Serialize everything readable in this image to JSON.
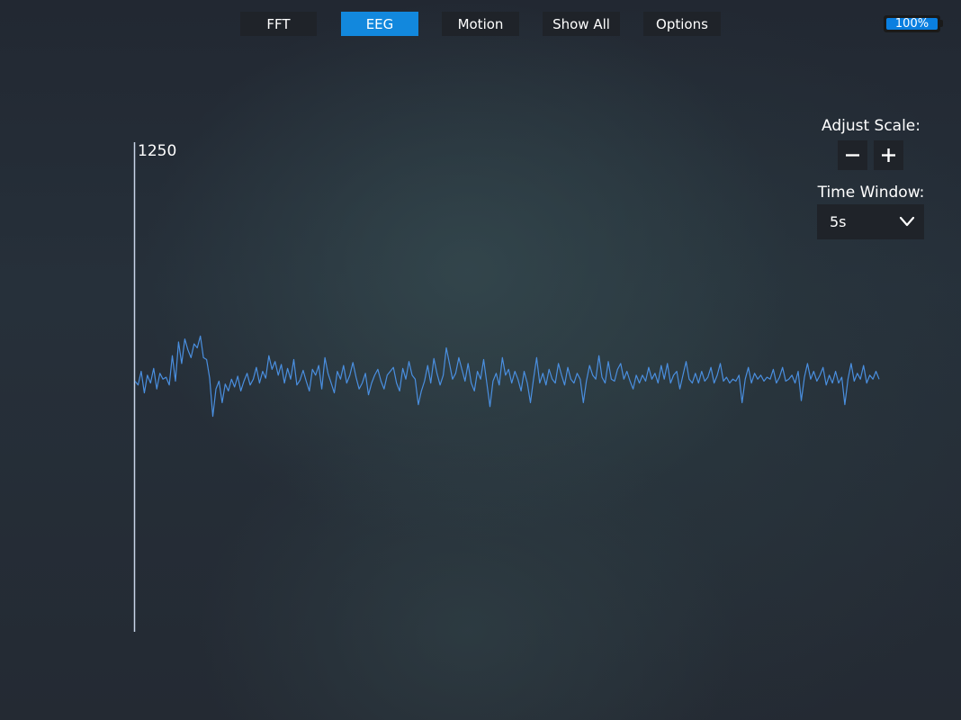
{
  "nav": {
    "tabs": [
      {
        "label": "FFT",
        "active": false
      },
      {
        "label": "EEG",
        "active": true
      },
      {
        "label": "Motion",
        "active": false
      },
      {
        "label": "Show All",
        "active": false
      },
      {
        "label": "Options",
        "active": false
      }
    ]
  },
  "battery": {
    "label": "100%",
    "level": 1.0,
    "color": "#0a7fe0"
  },
  "controls": {
    "adjust_scale_label": "Adjust Scale:",
    "minus_icon": "minus-icon",
    "plus_icon": "plus-icon",
    "time_window_label": "Time Window:",
    "time_window_value": "5s",
    "chevron_icon": "chevron-down-icon"
  },
  "colors": {
    "accent": "#1288dd",
    "signal": "#4a8fe0",
    "axis": "#c8d4e8",
    "button_bg": "#1f2329"
  },
  "chart_data": {
    "type": "line",
    "title": "",
    "xlabel": "",
    "ylabel": "",
    "y_max_label": "1250",
    "ylim": [
      -1250,
      1250
    ],
    "x_window_seconds": 5,
    "grid": false,
    "series": [
      {
        "name": "",
        "sample_rate_hz": 82,
        "values": [
          30,
          10,
          80,
          -30,
          60,
          20,
          95,
          -10,
          70,
          40,
          50,
          10,
          160,
          30,
          230,
          120,
          245,
          190,
          150,
          220,
          200,
          260,
          150,
          140,
          45,
          -150,
          -10,
          30,
          -80,
          15,
          -20,
          40,
          0,
          55,
          -20,
          30,
          70,
          10,
          40,
          100,
          20,
          80,
          45,
          160,
          90,
          130,
          60,
          115,
          20,
          95,
          40,
          140,
          10,
          35,
          85,
          30,
          -20,
          90,
          60,
          110,
          -10,
          150,
          70,
          20,
          -30,
          80,
          40,
          110,
          20,
          60,
          125,
          50,
          -10,
          20,
          70,
          -40,
          20,
          60,
          90,
          30,
          -10,
          60,
          80,
          100,
          20,
          -20,
          95,
          40,
          130,
          60,
          40,
          -90,
          -20,
          30,
          110,
          20,
          145,
          70,
          10,
          60,
          200,
          120,
          40,
          70,
          150,
          90,
          30,
          120,
          20,
          -20,
          80,
          40,
          140,
          20,
          -100,
          30,
          70,
          10,
          150,
          60,
          90,
          20,
          80,
          40,
          -20,
          80,
          20,
          -80,
          40,
          150,
          20,
          70,
          10,
          90,
          40,
          20,
          120,
          60,
          10,
          100,
          40,
          20,
          70,
          40,
          -80,
          30,
          110,
          60,
          40,
          160,
          50,
          20,
          130,
          40,
          30,
          90,
          120,
          40,
          80,
          30,
          -10,
          60,
          20,
          60,
          30,
          100,
          40,
          70,
          20,
          110,
          40,
          120,
          20,
          60,
          80,
          -10,
          60,
          130,
          40,
          20,
          70,
          20,
          80,
          30,
          50,
          100,
          20,
          60,
          120,
          30,
          50,
          20,
          40,
          30,
          60,
          -80,
          40,
          100,
          20,
          70,
          40,
          60,
          30,
          50,
          40,
          90,
          20,
          50,
          100,
          30,
          40,
          60,
          20,
          80,
          -70,
          50,
          120,
          40,
          80,
          30,
          60,
          100,
          10,
          60,
          20,
          80,
          20,
          50,
          -90,
          40,
          120,
          30,
          70,
          40,
          110,
          20,
          60,
          40,
          80,
          40
        ]
      }
    ]
  }
}
